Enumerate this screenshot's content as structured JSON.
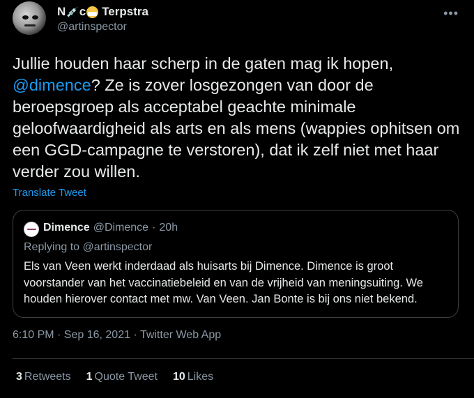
{
  "author": {
    "name_prefix": "N",
    "name_mid": "c",
    "name_suffix": "Terpstra",
    "handle": "@artinspector",
    "more_icon": "more-horizontal-icon"
  },
  "tweet": {
    "text_1": "Jullie houden haar scherp in de gaten mag ik hopen, ",
    "mention": "@dimence",
    "text_2": "? Ze is zover losgezongen van door de beroepsgroep als acceptabel geachte minimale geloofwaardigheid als arts en als mens (wappies ophitsen om een GGD-campagne te verstoren), dat ik zelf niet met haar verder zou willen.",
    "translate_label": "Translate Tweet"
  },
  "quote": {
    "name": "Dimence",
    "handle": "@Dimence",
    "separator": "·",
    "time": "20h",
    "reply_prefix": "Replying to ",
    "reply_to": "@artinspector",
    "body": "Els van Veen werkt inderdaad als huisarts bij Dimence. Dimence is groot voorstander van het vaccinatiebeleid en van de vrijheid van meningsuiting. We houden hierover contact met mw. Van Veen. Jan Bonte is bij ons niet bekend."
  },
  "meta": "6:10 PM · Sep 16, 2021 · Twitter Web App",
  "stats": {
    "retweets_count": "3",
    "retweets_label": "Retweets",
    "quotes_count": "1",
    "quotes_label": "Quote Tweet",
    "likes_count": "10",
    "likes_label": "Likes"
  },
  "colors": {
    "background": "#000000",
    "text": "#e7e9ea",
    "secondary": "#8b98a5",
    "link": "#1d9bf0"
  }
}
